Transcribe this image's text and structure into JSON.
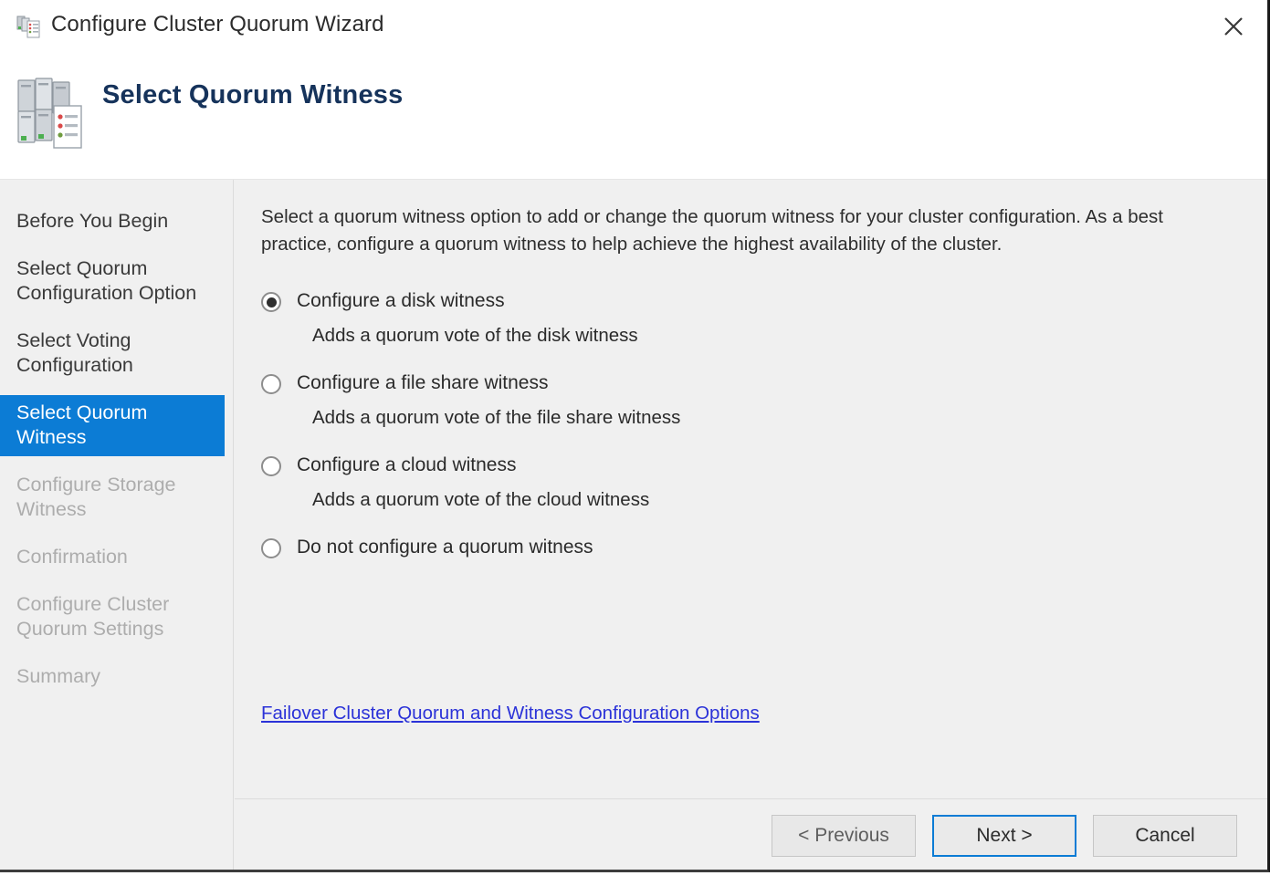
{
  "window": {
    "title": "Configure Cluster Quorum Wizard",
    "title_icon": "cluster-wizard-icon",
    "close_icon": "close-icon"
  },
  "header": {
    "title": "Select Quorum Witness",
    "icon": "cluster-servers-checklist-icon"
  },
  "sidebar": {
    "items": [
      {
        "label": "Before You Begin",
        "state": "done"
      },
      {
        "label": "Select Quorum\nConfiguration Option",
        "state": "done"
      },
      {
        "label": "Select Voting\nConfiguration",
        "state": "done"
      },
      {
        "label": "Select Quorum\nWitness",
        "state": "current"
      },
      {
        "label": "Configure Storage\nWitness",
        "state": "future"
      },
      {
        "label": "Confirmation",
        "state": "future"
      },
      {
        "label": "Configure Cluster\nQuorum Settings",
        "state": "future"
      },
      {
        "label": "Summary",
        "state": "future"
      }
    ]
  },
  "content": {
    "intro": "Select a quorum witness option to add or change the quorum witness for your cluster configuration. As a best practice, configure a quorum witness to help achieve the highest availability of the cluster.",
    "options": [
      {
        "label": "Configure a disk witness",
        "description": "Adds a quorum vote of the disk witness",
        "selected": true
      },
      {
        "label": "Configure a file share witness",
        "description": "Adds a quorum vote of the file share witness",
        "selected": false
      },
      {
        "label": "Configure a cloud witness",
        "description": "Adds a quorum vote of the cloud witness",
        "selected": false
      },
      {
        "label": "Do not configure a quorum witness",
        "description": "",
        "selected": false
      }
    ],
    "help_link": "Failover Cluster Quorum and Witness Configuration Options"
  },
  "footer": {
    "previous_label": "< Previous",
    "next_label": "Next >",
    "cancel_label": "Cancel"
  },
  "colors": {
    "accent": "#0c7cd5",
    "link": "#2b32d8",
    "header_title": "#16335b",
    "body_background": "#f0f0f0"
  }
}
